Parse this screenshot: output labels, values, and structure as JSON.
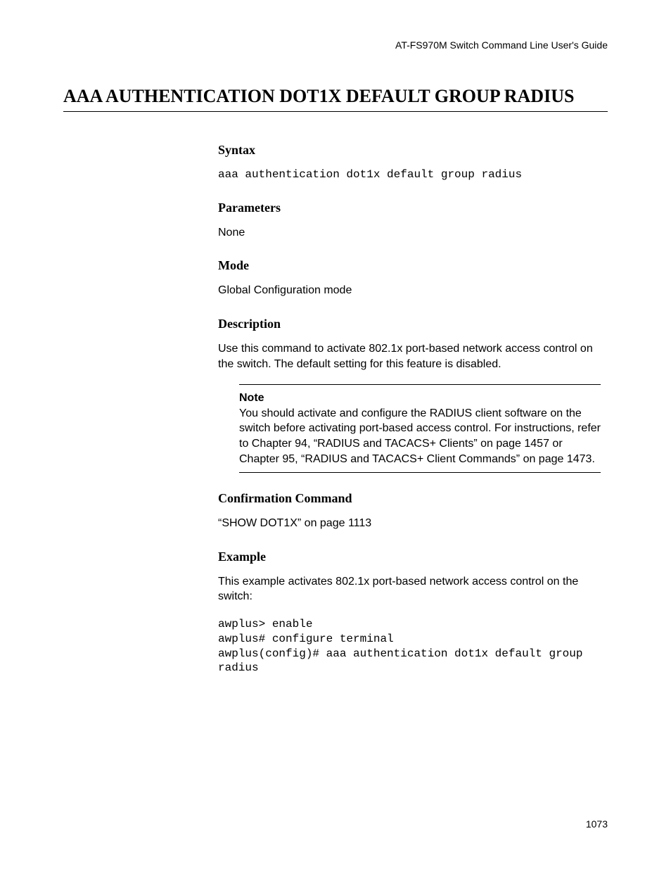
{
  "header": "AT-FS970M Switch Command Line User's Guide",
  "title": "AAA AUTHENTICATION DOT1X DEFAULT GROUP RADIUS",
  "sections": {
    "syntax": {
      "head": "Syntax",
      "code": "aaa authentication dot1x default group radius"
    },
    "parameters": {
      "head": "Parameters",
      "body": "None"
    },
    "mode": {
      "head": "Mode",
      "body": "Global Configuration mode"
    },
    "description": {
      "head": "Description",
      "body": "Use this command to activate 802.1x port-based network access control on the switch. The default setting for this feature is disabled."
    },
    "note": {
      "label": "Note",
      "body": "You should activate and configure the RADIUS client software on the switch before activating port-based access control. For instructions, refer to Chapter 94, “RADIUS and TACACS+ Clients” on page 1457 or Chapter 95, “RADIUS and TACACS+ Client Commands” on page 1473."
    },
    "confirmation": {
      "head": "Confirmation Command",
      "body": "“SHOW DOT1X” on page 1113"
    },
    "example": {
      "head": "Example",
      "body": "This example activates 802.1x port-based network access control on the switch:",
      "code": "awplus> enable\nawplus# configure terminal\nawplus(config)# aaa authentication dot1x default group radius"
    }
  },
  "page_number": "1073"
}
